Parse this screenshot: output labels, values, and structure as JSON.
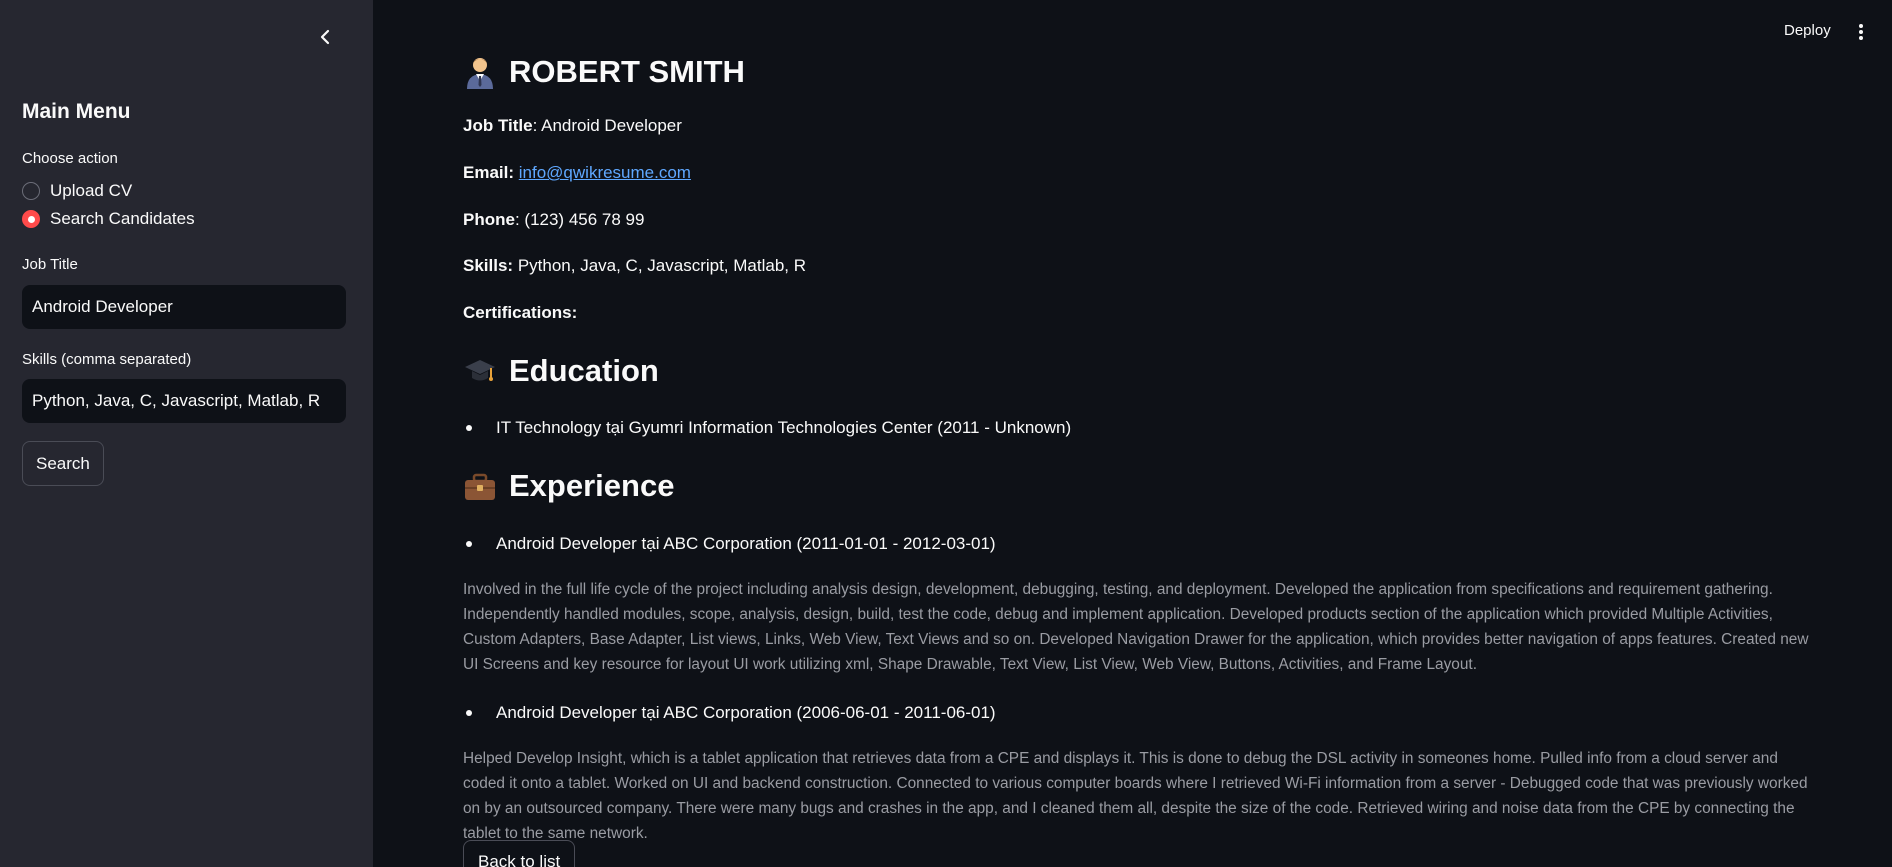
{
  "sidebar": {
    "title": "Main Menu",
    "choose_action_label": "Choose action",
    "actions": [
      {
        "label": "Upload CV",
        "selected": false
      },
      {
        "label": "Search Candidates",
        "selected": true
      }
    ],
    "job_title_label": "Job Title",
    "job_title_value": "Android Developer",
    "skills_label": "Skills (comma separated)",
    "skills_value": "Python, Java, C, Javascript, Matlab, R",
    "search_button": "Search",
    "accent_color": "#ff4b4b"
  },
  "header": {
    "deploy_label": "Deploy"
  },
  "profile": {
    "name": "ROBERT SMITH",
    "job_title_key": "Job Title",
    "job_title": "Android Developer",
    "email_key": "Email:",
    "email": "info@qwikresume.com",
    "phone_key": "Phone",
    "phone": "(123) 456 78 99",
    "skills_key": "Skills:",
    "skills": "Python, Java, C, Javascript, Matlab, R",
    "certifications_key": "Certifications:"
  },
  "education": {
    "heading": "Education",
    "items": [
      "IT Technology tại Gyumri Information Technologies Center (2011 - Unknown)"
    ]
  },
  "experience": {
    "heading": "Experience",
    "items": [
      {
        "title": "Android Developer tại ABC Corporation (2011-01-01 - 2012-03-01)",
        "description": "Involved in the full life cycle of the project including analysis design, development, debugging, testing, and deployment. Developed the application from specifications and requirement gathering. Independently handled modules, scope, analysis, design, build, test the code, debug and implement application. Developed products section of the application which provided Multiple Activities, Custom Adapters, Base Adapter, List views, Links, Web View, Text Views and so on. Developed Navigation Drawer for the application, which provides better navigation of apps features. Created new UI Screens and key resource for layout UI work utilizing xml, Shape Drawable, Text View, List View, Web View, Buttons, Activities, and Frame Layout."
      },
      {
        "title": "Android Developer tại ABC Corporation (2006-06-01 - 2011-06-01)",
        "description": "Helped Develop Insight, which is a tablet application that retrieves data from a CPE and displays it. This is done to debug the DSL activity in someones home. Pulled info from a cloud server and coded it onto a tablet. Worked on UI and backend construction. Connected to various computer boards where I retrieved Wi-Fi information from a server - Debugged code that was previously worked on by an outsourced company. There were many bugs and crashes in the app, and I cleaned them all, despite the size of the code. Retrieved wiring and noise data from the CPE by connecting the tablet to the same network."
      }
    ]
  },
  "back_button": "Back to list",
  "icons": {
    "collapse": "chevron-left-icon",
    "menu": "kebab-menu-icon",
    "person": "man-office-worker-icon",
    "education": "graduation-cap-icon",
    "experience": "briefcase-icon"
  }
}
